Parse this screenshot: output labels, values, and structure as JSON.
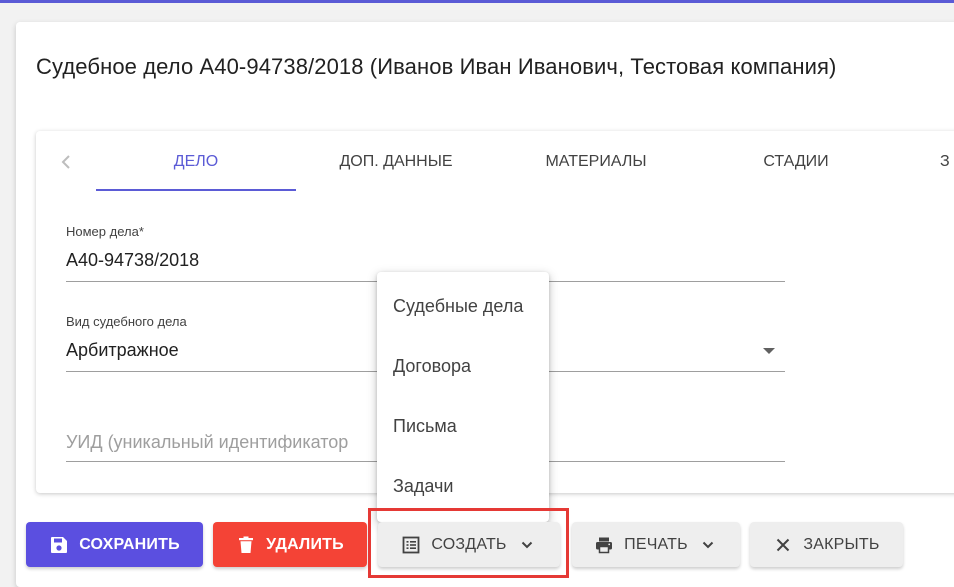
{
  "dialog": {
    "title": "Судебное дело А40-94738/2018 (Иванов Иван Иванович, Тестовая компания)"
  },
  "tabs": [
    {
      "label": "ДЕЛО",
      "active": true
    },
    {
      "label": "ДОП. ДАННЫЕ",
      "active": false
    },
    {
      "label": "МАТЕРИАЛЫ",
      "active": false
    },
    {
      "label": "СТАДИИ",
      "active": false
    },
    {
      "label": "З",
      "active": false
    }
  ],
  "form": {
    "case_number": {
      "label": "Номер дела*",
      "value": "А40-94738/2018"
    },
    "case_type": {
      "label": "Вид судебного дела",
      "value": "Арбитражное"
    },
    "uid": {
      "placeholder": "УИД (уникальный идентификатор"
    }
  },
  "create_menu": {
    "items": [
      "Судебные дела",
      "Договора",
      "Письма",
      "Задачи"
    ]
  },
  "buttons": {
    "save": "СОХРАНИТЬ",
    "delete": "УДАЛИТЬ",
    "create": "СОЗДАТЬ",
    "print": "ПЕЧАТЬ",
    "close": "ЗАКРЫТЬ"
  },
  "colors": {
    "accent": "#5b5bd6",
    "save_button": "#5b4fe0",
    "delete_button": "#f44336",
    "highlight": "#e53935"
  },
  "icons": {
    "tabs_prev": "chevron-left-icon",
    "save": "floppy-disk-icon",
    "delete": "trash-icon",
    "create": "list-icon",
    "print": "printer-icon",
    "close": "close-icon",
    "dropdown": "chevron-down-icon"
  }
}
